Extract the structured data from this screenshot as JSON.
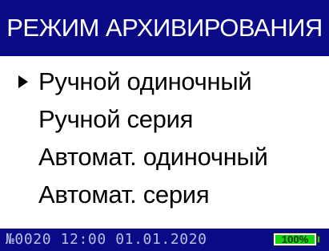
{
  "header": {
    "title": "РЕЖИМ АРХИВИРОВАНИЯ"
  },
  "menu": {
    "selected_index": 0,
    "items": [
      {
        "label": "Ручной одиночный"
      },
      {
        "label": "Ручной серия"
      },
      {
        "label": "Автомат. одиночный"
      },
      {
        "label": "Автомат. серия"
      }
    ]
  },
  "status": {
    "record_number": "№0020",
    "time": "12:00",
    "date": "01.01.2020",
    "text": "№0020 12:00 01.01.2020",
    "battery_label": "100%",
    "battery_level": 1.0
  },
  "colors": {
    "header_bg": "#0a0a86",
    "status_text": "#b9bfe6",
    "battery_fill": "#15d40a"
  },
  "icons": {
    "selection_pointer": "triangle-right-icon",
    "battery": "battery-icon"
  }
}
